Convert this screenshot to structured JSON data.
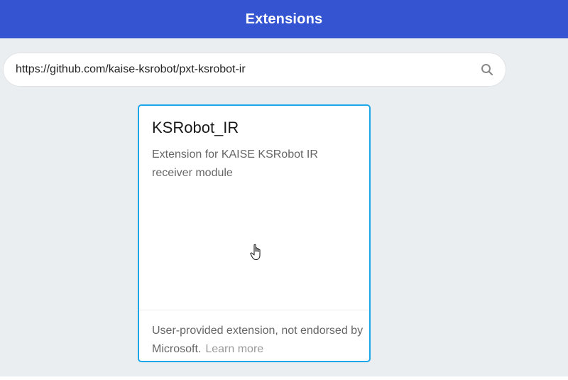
{
  "header": {
    "title": "Extensions",
    "background_color": "#3454d1"
  },
  "search": {
    "value": "https://github.com/kaise-ksrobot/pxt-ksrobot-ir",
    "icon": "search-icon"
  },
  "card": {
    "title": "KSRobot_IR",
    "description": "Extension for KAISE KSRobot IR receiver module",
    "footer_text": "User-provided extension, not endorsed by Microsoft.",
    "learn_more": "Learn more",
    "border_color": "#1ea7e8"
  },
  "cursor": {
    "icon": "hand-pointer-icon"
  }
}
